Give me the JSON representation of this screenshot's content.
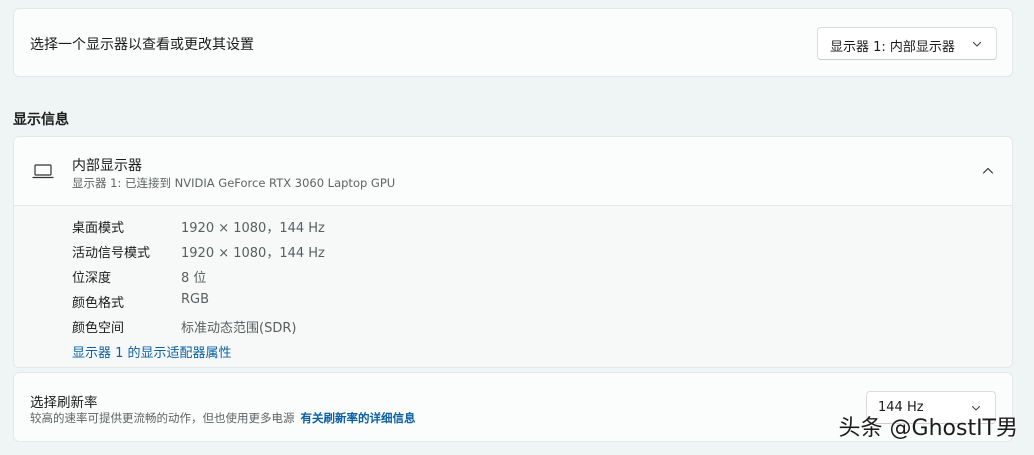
{
  "display_select": {
    "prompt": "选择一个显示器以查看或更改其设置",
    "dropdown_value": "显示器 1: 内部显示器"
  },
  "section_title": "显示信息",
  "display_info": {
    "title": "内部显示器",
    "subtitle": "显示器 1: 已连接到 NVIDIA GeForce RTX 3060 Laptop GPU",
    "rows": [
      {
        "label": "桌面模式",
        "value": "1920 × 1080，144 Hz"
      },
      {
        "label": "活动信号模式",
        "value": "1920 × 1080，144 Hz"
      },
      {
        "label": "位深度",
        "value": "8 位"
      },
      {
        "label": "颜色格式",
        "value": "RGB"
      },
      {
        "label": "颜色空间",
        "value": "标准动态范围(SDR)"
      }
    ],
    "adapter_link": "显示器 1 的显示适配器属性"
  },
  "refresh_rate": {
    "title": "选择刷新率",
    "description": "较高的速率可提供更流畅的动作，但也使用更多电源",
    "link": "有关刷新率的详细信息",
    "dropdown_value": "144 Hz"
  },
  "watermark": "头条 @GhostIT男",
  "icons": {
    "display": "laptop-icon",
    "collapse": "chevron-up-icon",
    "dropdown": "chevron-down-icon"
  },
  "colors": {
    "accent_link": "#0b5fa5",
    "background": "#eef5f4",
    "card": "#fbfcfc"
  }
}
